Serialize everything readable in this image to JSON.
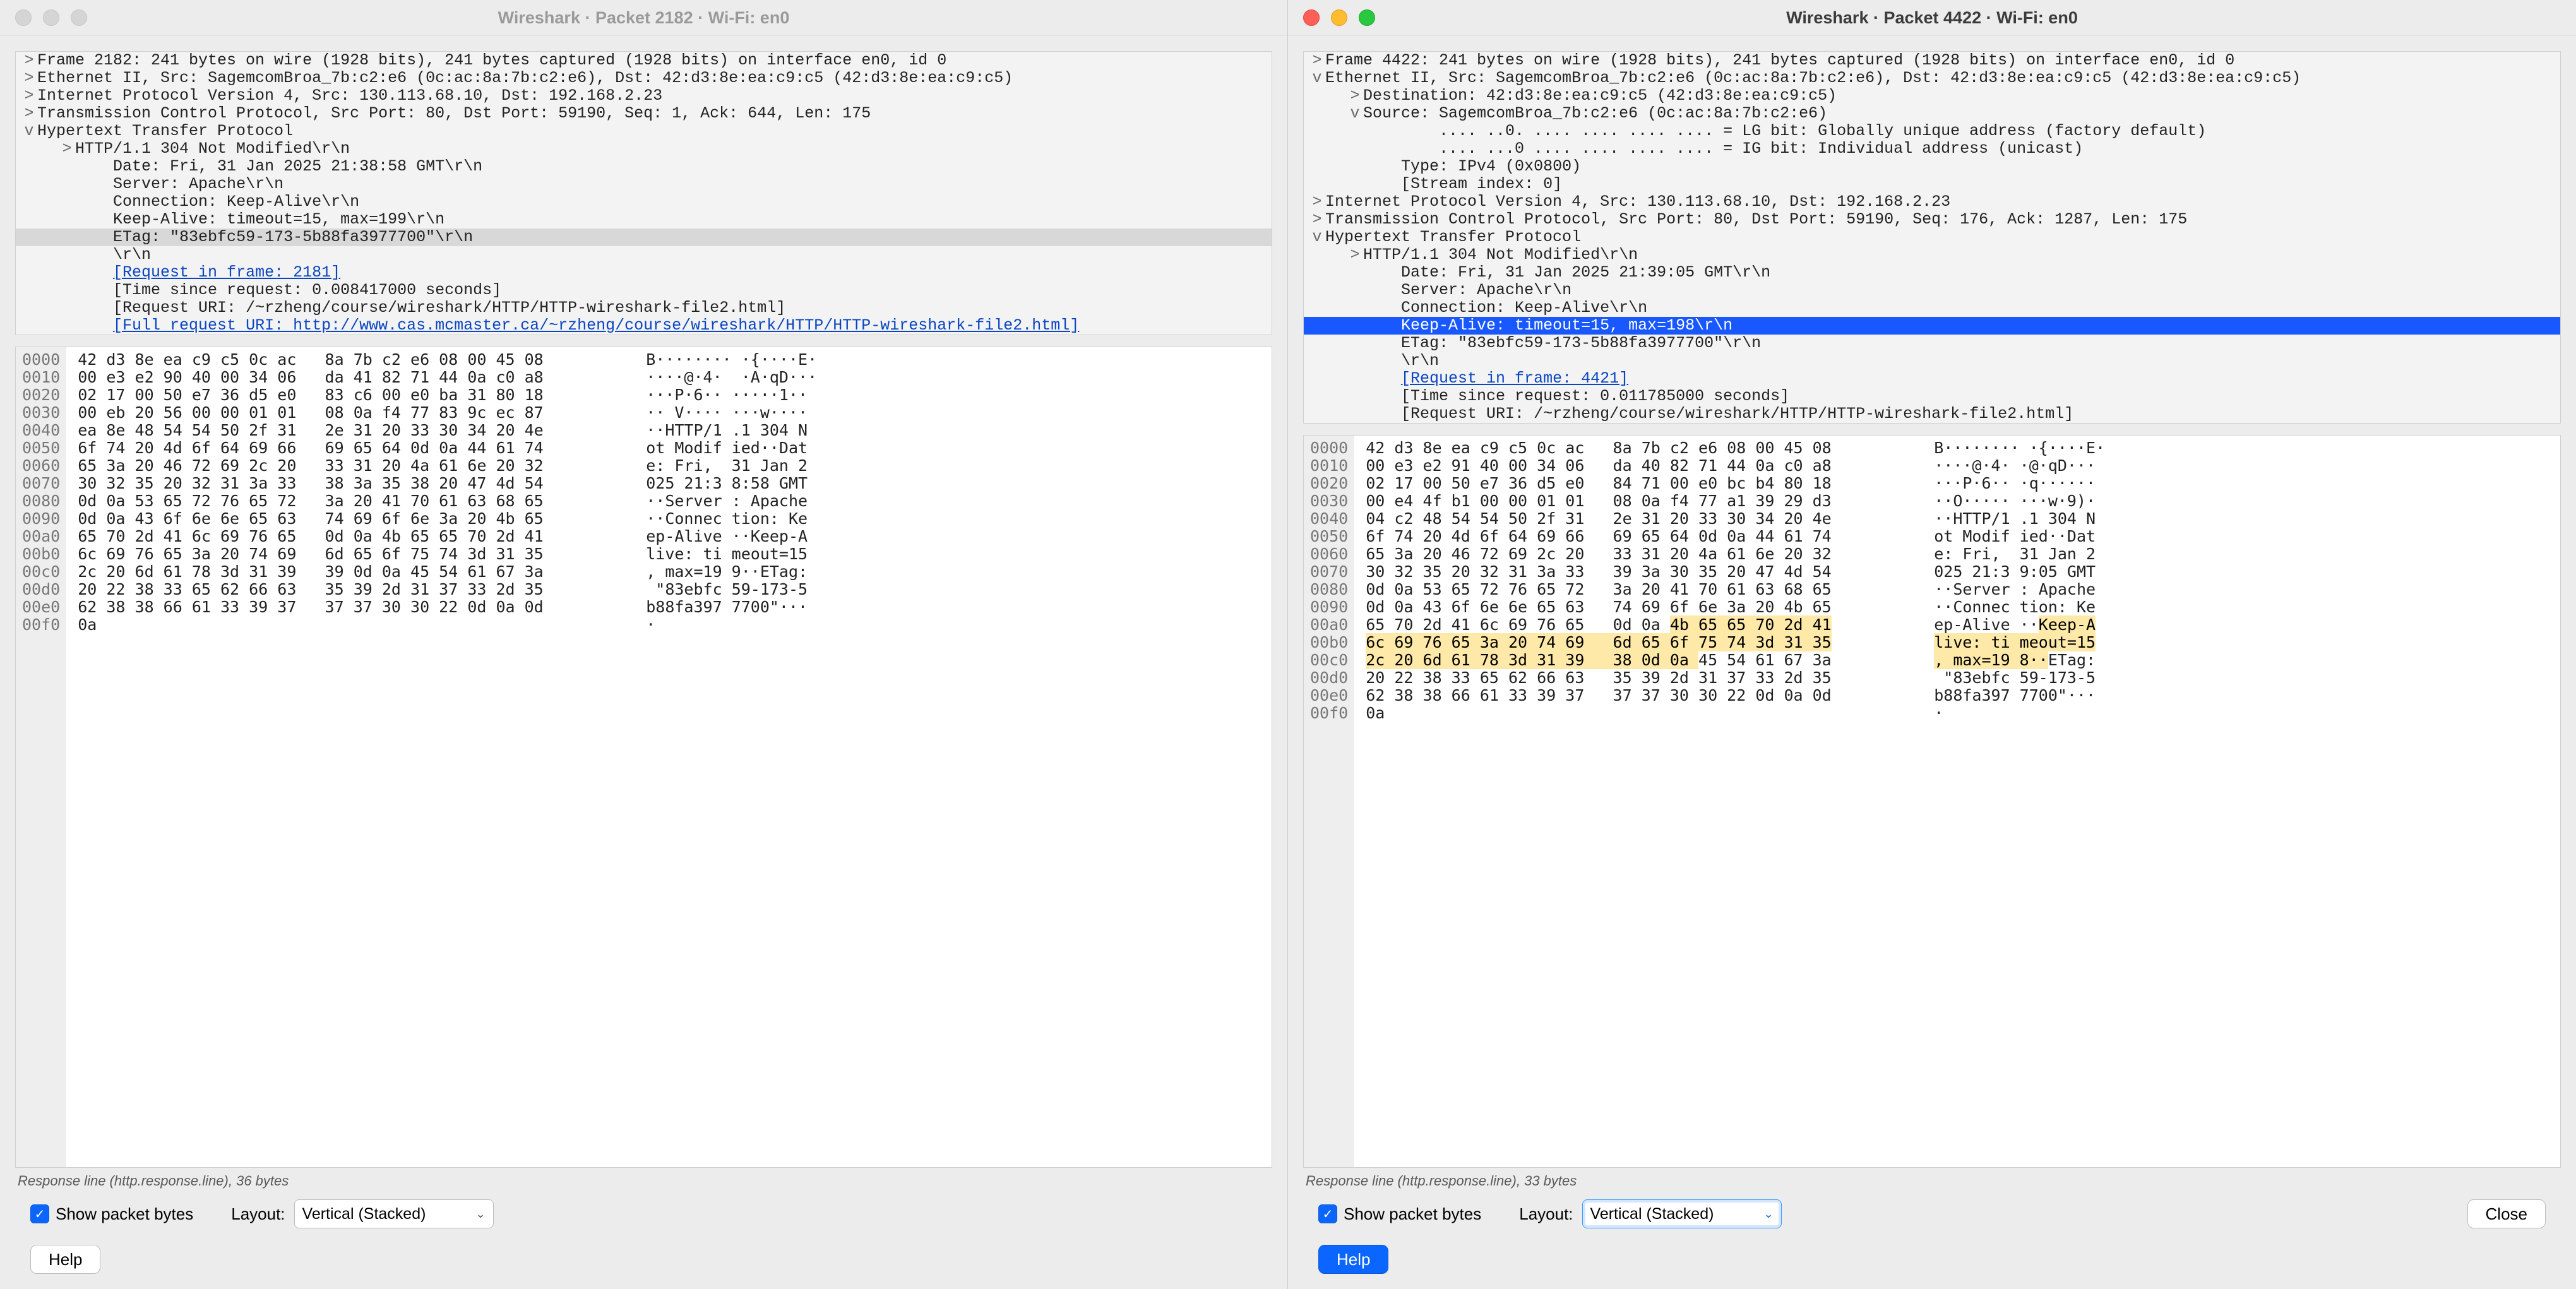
{
  "windows": {
    "left": {
      "title": "Wireshark · Packet 2182 · Wi-Fi: en0",
      "tree": [
        {
          "ind": 0,
          "tw": ">",
          "text": "Frame 2182: 241 bytes on wire (1928 bits), 241 bytes captured (1928 bits) on interface en0, id 0"
        },
        {
          "ind": 0,
          "tw": ">",
          "text": "Ethernet II, Src: SagemcomBroa_7b:c2:e6 (0c:ac:8a:7b:c2:e6), Dst: 42:d3:8e:ea:c9:c5 (42:d3:8e:ea:c9:c5)"
        },
        {
          "ind": 0,
          "tw": ">",
          "text": "Internet Protocol Version 4, Src: 130.113.68.10, Dst: 192.168.2.23"
        },
        {
          "ind": 0,
          "tw": ">",
          "text": "Transmission Control Protocol, Src Port: 80, Dst Port: 59190, Seq: 1, Ack: 644, Len: 175"
        },
        {
          "ind": 0,
          "tw": "v",
          "text": "Hypertext Transfer Protocol"
        },
        {
          "ind": 1,
          "tw": ">",
          "text": "HTTP/1.1 304 Not Modified\\r\\n"
        },
        {
          "ind": 2,
          "tw": "",
          "text": "Date: Fri, 31 Jan 2025 21:38:58 GMT\\r\\n"
        },
        {
          "ind": 2,
          "tw": "",
          "text": "Server: Apache\\r\\n"
        },
        {
          "ind": 2,
          "tw": "",
          "text": "Connection: Keep-Alive\\r\\n"
        },
        {
          "ind": 2,
          "tw": "",
          "text": "Keep-Alive: timeout=15, max=199\\r\\n"
        },
        {
          "ind": 2,
          "tw": "",
          "text": "ETag: \"83ebfc59-173-5b88fa3977700\"\\r\\n",
          "sel": "grey"
        },
        {
          "ind": 2,
          "tw": "",
          "text": "\\r\\n"
        },
        {
          "ind": 2,
          "tw": "",
          "text": "[Request in frame: 2181]",
          "link": true
        },
        {
          "ind": 2,
          "tw": "",
          "text": "[Time since request: 0.008417000 seconds]"
        },
        {
          "ind": 2,
          "tw": "",
          "text": "[Request URI: /~rzheng/course/wireshark/HTTP/HTTP-wireshark-file2.html]"
        },
        {
          "ind": 2,
          "tw": "",
          "text": "[Full request URI: http://www.cas.mcmaster.ca/~rzheng/course/wireshark/HTTP/HTTP-wireshark-file2.html]",
          "link": true
        }
      ],
      "hex": {
        "offsets": [
          "0000",
          "0010",
          "0020",
          "0030",
          "0040",
          "0050",
          "0060",
          "0070",
          "0080",
          "0090",
          "00a0",
          "00b0",
          "00c0",
          "00d0",
          "00e0",
          "00f0"
        ],
        "rows": [
          {
            "bytes": "42 d3 8e ea c9 c5 0c ac   8a 7b c2 e6 08 00 45 08",
            "ascii": "B········ ·{····E·"
          },
          {
            "bytes": "00 e3 e2 90 40 00 34 06   da 41 82 71 44 0a c0 a8",
            "ascii": "····@·4·  ·A·qD···"
          },
          {
            "bytes": "02 17 00 50 e7 36 d5 e0   83 c6 00 e0 ba 31 80 18",
            "ascii": "···P·6·· ·····1··"
          },
          {
            "bytes": "00 eb 20 56 00 00 01 01   08 0a f4 77 83 9c ec 87",
            "ascii": "·· V···· ···w····"
          },
          {
            "bytes": "ea 8e 48 54 54 50 2f 31   2e 31 20 33 30 34 20 4e",
            "ascii": "··HTTP/1 .1 304 N"
          },
          {
            "bytes": "6f 74 20 4d 6f 64 69 66   69 65 64 0d 0a 44 61 74",
            "ascii": "ot Modif ied··Dat"
          },
          {
            "bytes": "65 3a 20 46 72 69 2c 20   33 31 20 4a 61 6e 20 32",
            "ascii": "e: Fri,  31 Jan 2"
          },
          {
            "bytes": "30 32 35 20 32 31 3a 33   38 3a 35 38 20 47 4d 54",
            "ascii": "025 21:3 8:58 GMT"
          },
          {
            "bytes": "0d 0a 53 65 72 76 65 72   3a 20 41 70 61 63 68 65",
            "ascii": "··Server : Apache"
          },
          {
            "bytes": "0d 0a 43 6f 6e 6e 65 63   74 69 6f 6e 3a 20 4b 65",
            "ascii": "··Connec tion: Ke"
          },
          {
            "bytes": "65 70 2d 41 6c 69 76 65   0d 0a 4b 65 65 70 2d 41",
            "ascii": "ep-Alive ··Keep-A"
          },
          {
            "bytes": "6c 69 76 65 3a 20 74 69   6d 65 6f 75 74 3d 31 35",
            "ascii": "live: ti meout=15"
          },
          {
            "bytes": "2c 20 6d 61 78 3d 31 39   39 0d 0a 45 54 61 67 3a",
            "ascii": ", max=19 9··ETag:"
          },
          {
            "bytes": "20 22 38 33 65 62 66 63   35 39 2d 31 37 33 2d 35",
            "ascii": " \"83ebfc 59-173-5"
          },
          {
            "bytes": "62 38 38 66 61 33 39 37   37 37 30 30 22 0d 0a 0d",
            "ascii": "b88fa397 7700\"···"
          },
          {
            "bytes": "0a",
            "ascii": "·"
          }
        ]
      },
      "status": "Response line (http.response.line), 36 bytes",
      "check_label": "Show packet bytes",
      "layout_label": "Layout:",
      "layout_value": "Vertical (Stacked)",
      "help": "Help"
    },
    "right": {
      "title": "Wireshark · Packet 4422 · Wi-Fi: en0",
      "tree": [
        {
          "ind": 0,
          "tw": ">",
          "text": "Frame 4422: 241 bytes on wire (1928 bits), 241 bytes captured (1928 bits) on interface en0, id 0"
        },
        {
          "ind": 0,
          "tw": "v",
          "text": "Ethernet II, Src: SagemcomBroa_7b:c2:e6 (0c:ac:8a:7b:c2:e6), Dst: 42:d3:8e:ea:c9:c5 (42:d3:8e:ea:c9:c5)"
        },
        {
          "ind": 1,
          "tw": ">",
          "text": "Destination: 42:d3:8e:ea:c9:c5 (42:d3:8e:ea:c9:c5)"
        },
        {
          "ind": 1,
          "tw": "v",
          "text": "Source: SagemcomBroa_7b:c2:e6 (0c:ac:8a:7b:c2:e6)"
        },
        {
          "ind": 3,
          "tw": "",
          "text": ".... ..0. .... .... .... .... = LG bit: Globally unique address (factory default)"
        },
        {
          "ind": 3,
          "tw": "",
          "text": ".... ...0 .... .... .... .... = IG bit: Individual address (unicast)"
        },
        {
          "ind": 2,
          "tw": "",
          "text": "Type: IPv4 (0x0800)"
        },
        {
          "ind": 2,
          "tw": "",
          "text": "[Stream index: 0]"
        },
        {
          "ind": 0,
          "tw": ">",
          "text": "Internet Protocol Version 4, Src: 130.113.68.10, Dst: 192.168.2.23"
        },
        {
          "ind": 0,
          "tw": ">",
          "text": "Transmission Control Protocol, Src Port: 80, Dst Port: 59190, Seq: 176, Ack: 1287, Len: 175"
        },
        {
          "ind": 0,
          "tw": "v",
          "text": "Hypertext Transfer Protocol"
        },
        {
          "ind": 1,
          "tw": ">",
          "text": "HTTP/1.1 304 Not Modified\\r\\n"
        },
        {
          "ind": 2,
          "tw": "",
          "text": "Date: Fri, 31 Jan 2025 21:39:05 GMT\\r\\n"
        },
        {
          "ind": 2,
          "tw": "",
          "text": "Server: Apache\\r\\n"
        },
        {
          "ind": 2,
          "tw": "",
          "text": "Connection: Keep-Alive\\r\\n"
        },
        {
          "ind": 2,
          "tw": "",
          "text": "Keep-Alive: timeout=15, max=198\\r\\n",
          "sel": "blue"
        },
        {
          "ind": 2,
          "tw": "",
          "text": "ETag: \"83ebfc59-173-5b88fa3977700\"\\r\\n"
        },
        {
          "ind": 2,
          "tw": "",
          "text": "\\r\\n"
        },
        {
          "ind": 2,
          "tw": "",
          "text": "[Request in frame: 4421]",
          "link": true
        },
        {
          "ind": 2,
          "tw": "",
          "text": "[Time since request: 0.011785000 seconds]"
        },
        {
          "ind": 2,
          "tw": "",
          "text": "[Request URI: /~rzheng/course/wireshark/HTTP/HTTP-wireshark-file2.html]"
        }
      ],
      "hex": {
        "offsets": [
          "0000",
          "0010",
          "0020",
          "0030",
          "0040",
          "0050",
          "0060",
          "0070",
          "0080",
          "0090",
          "00a0",
          "00b0",
          "00c0",
          "00d0",
          "00e0",
          "00f0"
        ],
        "rows": [
          {
            "bytes": "42 d3 8e ea c9 c5 0c ac   8a 7b c2 e6 08 00 45 08",
            "ascii": "B········ ·{····E·"
          },
          {
            "bytes": "00 e3 e2 91 40 00 34 06   da 40 82 71 44 0a c0 a8",
            "ascii": "····@·4· ·@·qD···"
          },
          {
            "bytes": "02 17 00 50 e7 36 d5 e0   84 71 00 e0 bc b4 80 18",
            "ascii": "···P·6·· ·q······"
          },
          {
            "bytes": "00 e4 4f b1 00 00 01 01   08 0a f4 77 a1 39 29 d3",
            "ascii": "··O····· ···w·9)·"
          },
          {
            "bytes": "04 c2 48 54 54 50 2f 31   2e 31 20 33 30 34 20 4e",
            "ascii": "··HTTP/1 .1 304 N"
          },
          {
            "bytes": "6f 74 20 4d 6f 64 69 66   69 65 64 0d 0a 44 61 74",
            "ascii": "ot Modif ied··Dat"
          },
          {
            "bytes": "65 3a 20 46 72 69 2c 20   33 31 20 4a 61 6e 20 32",
            "ascii": "e: Fri,  31 Jan 2"
          },
          {
            "bytes": "30 32 35 20 32 31 3a 33   39 3a 30 35 20 47 4d 54",
            "ascii": "025 21:3 9:05 GMT"
          },
          {
            "bytes": "0d 0a 53 65 72 76 65 72   3a 20 41 70 61 63 68 65",
            "ascii": "··Server : Apache"
          },
          {
            "bytes": "0d 0a 43 6f 6e 6e 65 63   74 69 6f 6e 3a 20 4b 65",
            "ascii": "··Connec tion: Ke"
          },
          {
            "bytes_pre": "65 70 2d 41 6c 69 76 65   0d 0a ",
            "bytes_hl": "4b 65 65 70 2d 41",
            "ascii_pre": "ep-Alive ··",
            "ascii_hl": "Keep-A"
          },
          {
            "bytes_hl": "6c 69 76 65 3a 20 74 69   6d 65 6f 75 74 3d 31 35",
            "ascii_hl": "live: ti meout=15"
          },
          {
            "bytes_hl": "2c 20 6d 61 78 3d 31 39   38 0d 0a ",
            "bytes_post": "45 54 61 67 3a",
            "ascii_hl": ", max=19 8··",
            "ascii_post": "ETag:"
          },
          {
            "bytes": "20 22 38 33 65 62 66 63   35 39 2d 31 37 33 2d 35",
            "ascii": " \"83ebfc 59-173-5"
          },
          {
            "bytes": "62 38 38 66 61 33 39 37   37 37 30 30 22 0d 0a 0d",
            "ascii": "b88fa397 7700\"···"
          },
          {
            "bytes": "0a",
            "ascii": "·"
          }
        ]
      },
      "status": "Response line (http.response.line), 33 bytes",
      "check_label": "Show packet bytes",
      "layout_label": "Layout:",
      "layout_value": "Vertical (Stacked)",
      "help": "Help",
      "close": "Close"
    }
  }
}
